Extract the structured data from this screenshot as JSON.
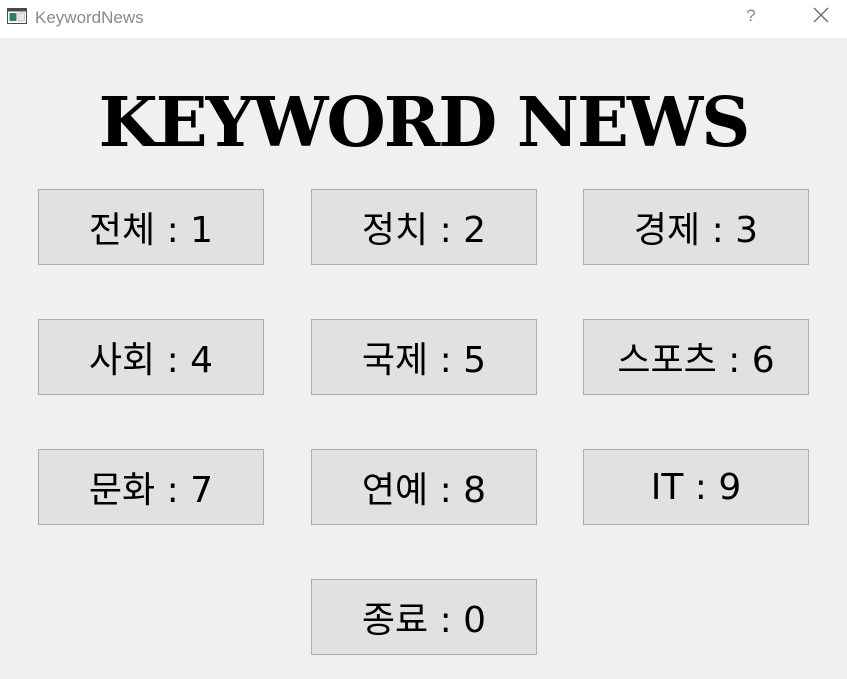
{
  "window": {
    "title": "KeywordNews",
    "help_label": "?",
    "app_icon": "window-app-icon",
    "close_icon": "close-icon"
  },
  "main": {
    "heading": "KEYWORD NEWS",
    "buttons": [
      {
        "label": "전체 : 1"
      },
      {
        "label": "정치 : 2"
      },
      {
        "label": "경제 : 3"
      },
      {
        "label": "사회 : 4"
      },
      {
        "label": "국제 : 5"
      },
      {
        "label": "스포츠 : 6"
      },
      {
        "label": "문화 : 7"
      },
      {
        "label": "연예 : 8"
      },
      {
        "label": "IT : 9"
      },
      {
        "label": "종료 : 0"
      }
    ]
  },
  "colors": {
    "window_bg": "#f0f0f0",
    "titlebar_bg": "#ffffff",
    "button_bg": "#e1e1e1",
    "button_border": "#adadad",
    "title_text": "#8a8a8a"
  }
}
